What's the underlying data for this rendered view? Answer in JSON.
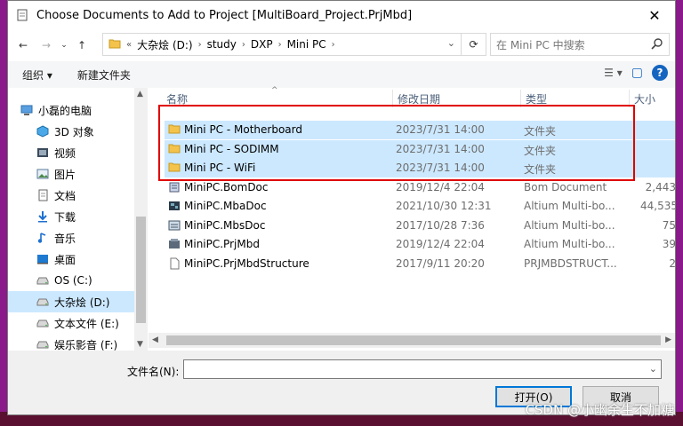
{
  "window": {
    "title": "Choose Documents to Add to Project [MultiBoard_Project.PrjMbd]",
    "close": "✕"
  },
  "nav": {
    "back": "←",
    "forward": "→",
    "up": "↑",
    "refresh": "⟳"
  },
  "address": {
    "prefix": "«",
    "segments": [
      "大杂烩 (D:)",
      "study",
      "DXP",
      "Mini PC"
    ],
    "sep": "›"
  },
  "search": {
    "placeholder": "在 Mini PC 中搜索",
    "icon": "search-icon"
  },
  "toolbar": {
    "organize": "组织 ▾",
    "new_folder": "新建文件夹",
    "view_icon": "☰ ▾",
    "pane_icon": "▢",
    "help": "?"
  },
  "sidebar": {
    "items": [
      {
        "label": "小磊的电脑",
        "icon": "computer-icon",
        "root": true,
        "selected": false
      },
      {
        "label": "3D 对象",
        "icon": "cube-icon",
        "selected": false
      },
      {
        "label": "视频",
        "icon": "video-icon",
        "selected": false
      },
      {
        "label": "图片",
        "icon": "image-icon",
        "selected": false
      },
      {
        "label": "文档",
        "icon": "document-icon",
        "selected": false
      },
      {
        "label": "下载",
        "icon": "download-icon",
        "selected": false
      },
      {
        "label": "音乐",
        "icon": "music-icon",
        "selected": false
      },
      {
        "label": "桌面",
        "icon": "desktop-icon",
        "selected": false
      },
      {
        "label": "OS (C:)",
        "icon": "drive-icon",
        "selected": false
      },
      {
        "label": "大杂烩 (D:)",
        "icon": "drive-icon",
        "selected": true
      },
      {
        "label": "文本文件 (E:)",
        "icon": "drive-icon",
        "selected": false
      },
      {
        "label": "娱乐影音 (F:)",
        "icon": "drive-icon",
        "selected": false
      }
    ]
  },
  "columns": {
    "name": "名称",
    "date": "修改日期",
    "type": "类型",
    "size": "大小"
  },
  "files": [
    {
      "name": "Mini PC - Motherboard",
      "date": "2023/7/31 14:00",
      "type": "文件夹",
      "size": "",
      "icon": "folder-icon",
      "selected": true
    },
    {
      "name": "Mini PC - SODIMM",
      "date": "2023/7/31 14:00",
      "type": "文件夹",
      "size": "",
      "icon": "folder-icon",
      "selected": true
    },
    {
      "name": "Mini PC - WiFi",
      "date": "2023/7/31 14:00",
      "type": "文件夹",
      "size": "",
      "icon": "folder-icon",
      "selected": true
    },
    {
      "name": "MiniPC.BomDoc",
      "date": "2019/12/4 22:04",
      "type": "Bom Document",
      "size": "2,443",
      "icon": "bom-file-icon",
      "selected": false
    },
    {
      "name": "MiniPC.MbaDoc",
      "date": "2021/10/30 12:31",
      "type": "Altium Multi-bo...",
      "size": "44,535",
      "icon": "altium-mba-icon",
      "selected": false
    },
    {
      "name": "MiniPC.MbsDoc",
      "date": "2017/10/28 7:36",
      "type": "Altium Multi-bo...",
      "size": "75",
      "icon": "altium-mbs-icon",
      "selected": false
    },
    {
      "name": "MiniPC.PrjMbd",
      "date": "2019/12/4 22:04",
      "type": "Altium Multi-bo...",
      "size": "39",
      "icon": "altium-project-icon",
      "selected": false
    },
    {
      "name": "MiniPC.PrjMbdStructure",
      "date": "2017/9/11 20:20",
      "type": "PRJMBDSTRUCT...",
      "size": "2",
      "icon": "generic-file-icon",
      "selected": false
    }
  ],
  "footer": {
    "filename_label": "文件名(N):",
    "filename_value": "",
    "open": "打开(O)",
    "cancel": "取消"
  },
  "watermark": "CSDN @小幽余生不加糖"
}
